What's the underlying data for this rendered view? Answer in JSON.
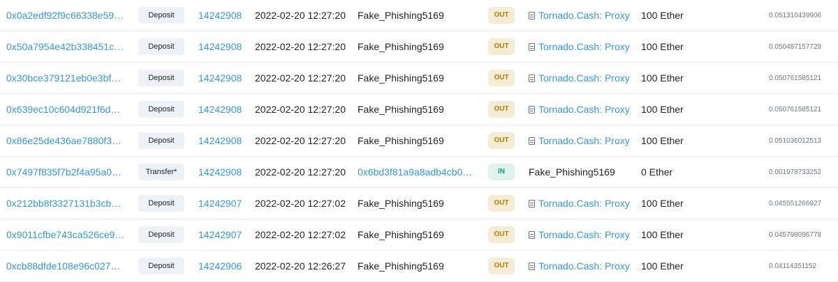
{
  "rows": [
    {
      "hash": "0x0a2edf92f9c66338e59…",
      "method": "Deposit",
      "block": "14242908",
      "age": "2022-02-20 12:27:20",
      "from": "Fake_Phishing5169",
      "from_is_link": false,
      "direction": "OUT",
      "to": "Tornado.Cash: Proxy",
      "to_is_link": true,
      "value": "100 Ether",
      "fee": "0.051310439906"
    },
    {
      "hash": "0x50a7954e42b338451c…",
      "method": "Deposit",
      "block": "14242908",
      "age": "2022-02-20 12:27:20",
      "from": "Fake_Phishing5169",
      "from_is_link": false,
      "direction": "OUT",
      "to": "Tornado.Cash: Proxy",
      "to_is_link": true,
      "value": "100 Ether",
      "fee": "0.050487157729"
    },
    {
      "hash": "0x30bce379121eb0e3bf…",
      "method": "Deposit",
      "block": "14242908",
      "age": "2022-02-20 12:27:20",
      "from": "Fake_Phishing5169",
      "from_is_link": false,
      "direction": "OUT",
      "to": "Tornado.Cash: Proxy",
      "to_is_link": true,
      "value": "100 Ether",
      "fee": "0.050761585121"
    },
    {
      "hash": "0x639ec10c604d921f6d…",
      "method": "Deposit",
      "block": "14242908",
      "age": "2022-02-20 12:27:20",
      "from": "Fake_Phishing5169",
      "from_is_link": false,
      "direction": "OUT",
      "to": "Tornado.Cash: Proxy",
      "to_is_link": true,
      "value": "100 Ether",
      "fee": "0.050761585121"
    },
    {
      "hash": "0x86e25de436ae7880f3…",
      "method": "Deposit",
      "block": "14242908",
      "age": "2022-02-20 12:27:20",
      "from": "Fake_Phishing5169",
      "from_is_link": false,
      "direction": "OUT",
      "to": "Tornado.Cash: Proxy",
      "to_is_link": true,
      "value": "100 Ether",
      "fee": "0.051036012513"
    },
    {
      "hash": "0x7497f835f7b2f4a95a0…",
      "method": "Transfer*",
      "block": "14242908",
      "age": "2022-02-20 12:27:20",
      "from": "0x6bd3f81a9a8adb4cb0…",
      "from_is_link": true,
      "direction": "IN",
      "to": "Fake_Phishing5169",
      "to_is_link": false,
      "value": "0 Ether",
      "fee": "0.001978733252"
    },
    {
      "hash": "0x212bb8f3327131b3cb…",
      "method": "Deposit",
      "block": "14242907",
      "age": "2022-02-20 12:27:02",
      "from": "Fake_Phishing5169",
      "from_is_link": false,
      "direction": "OUT",
      "to": "Tornado.Cash: Proxy",
      "to_is_link": true,
      "value": "100 Ether",
      "fee": "0.045551266927"
    },
    {
      "hash": "0x9011cfbe743ca526ce9…",
      "method": "Deposit",
      "block": "14242907",
      "age": "2022-02-20 12:27:02",
      "from": "Fake_Phishing5169",
      "from_is_link": false,
      "direction": "OUT",
      "to": "Tornado.Cash: Proxy",
      "to_is_link": true,
      "value": "100 Ether",
      "fee": "0.045798096778"
    },
    {
      "hash": "0xcb88dfde108e96c027…",
      "method": "Deposit",
      "block": "14242906",
      "age": "2022-02-20 12:26:27",
      "from": "Fake_Phishing5169",
      "from_is_link": false,
      "direction": "OUT",
      "to": "Tornado.Cash: Proxy",
      "to_is_link": true,
      "value": "100 Ether",
      "fee": "0.04114351152"
    }
  ]
}
